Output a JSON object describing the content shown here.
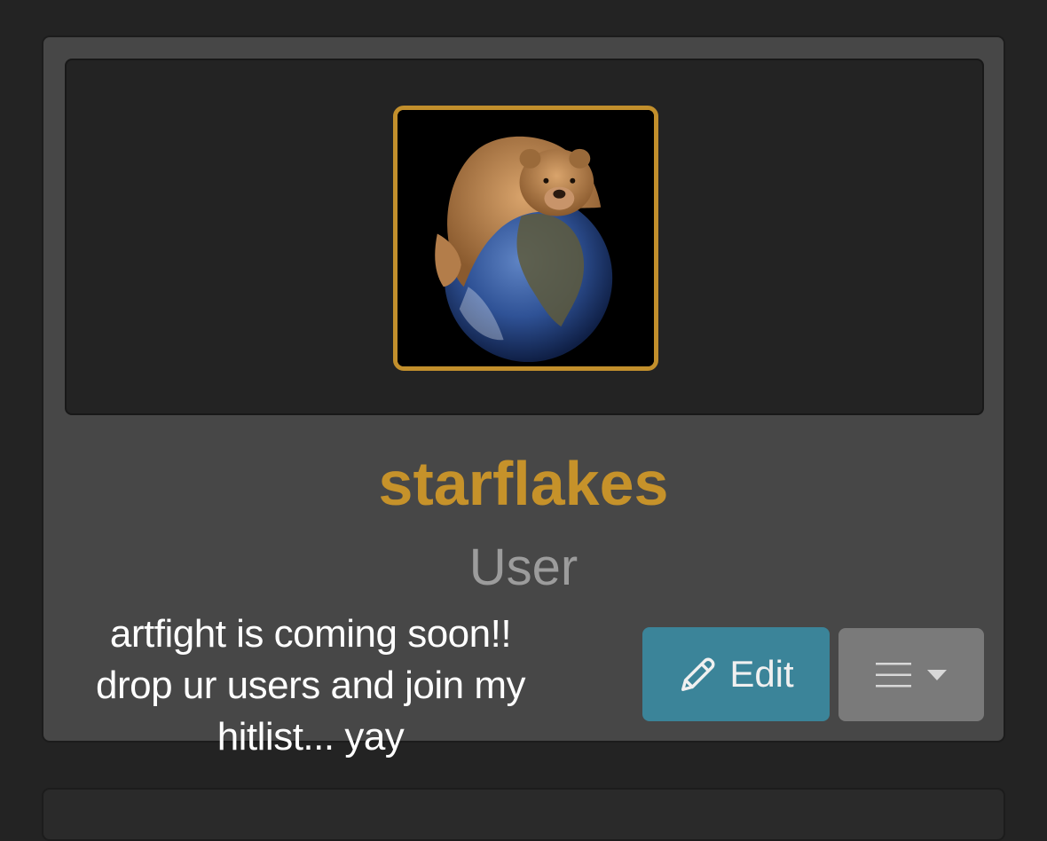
{
  "profile": {
    "username": "starflakes",
    "role": "User",
    "avatar": {
      "icon": "bear-on-globe-avatar",
      "border_color": "#c28f2c"
    },
    "accent_color": "#c6922a"
  },
  "actions": {
    "edit_label": "Edit",
    "edit_icon": "pencil-icon",
    "edit_color": "#3b8499",
    "menu_icon": "hamburger-icon",
    "menu_dropdown_icon": "caret-down-icon"
  },
  "caption": {
    "lines": [
      "artfight is coming soon!!",
      "drop ur users and join my",
      "hitlist... yay"
    ]
  }
}
